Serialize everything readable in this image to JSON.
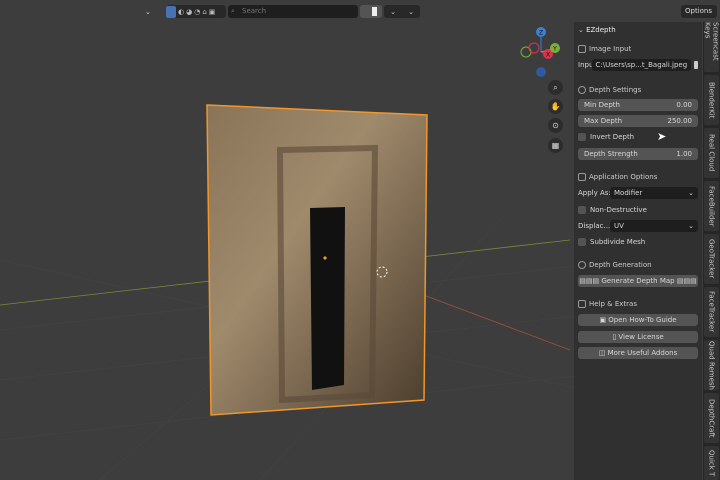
{
  "header": {
    "search_placeholder": "Search",
    "options_label": "Options"
  },
  "gizmo": {
    "z": "Z",
    "y": "Y",
    "x": "X"
  },
  "panel": {
    "title": "EZdepth",
    "image_input": {
      "heading": "Image Input",
      "label": "Input I...",
      "value": "C:\\Users\\sp...t_Bagali.jpeg"
    },
    "depth_settings": {
      "heading": "Depth Settings",
      "min_label": "Min Depth",
      "min_value": "0.00",
      "max_label": "Max Depth",
      "max_value": "250.00",
      "invert_label": "Invert Depth",
      "strength_label": "Depth Strength",
      "strength_value": "1.00"
    },
    "application": {
      "heading": "Application Options",
      "apply_label": "Apply As:",
      "apply_value": "Modifier",
      "nondestructive_label": "Non-Destructive",
      "displace_label": "Displac...",
      "displace_value": "UV",
      "subdivide_label": "Subdivide Mesh"
    },
    "generation": {
      "heading": "Depth Generation",
      "button": "Generate Depth Map"
    },
    "help": {
      "heading": "Help & Extras",
      "guide": "Open How-To Guide",
      "license": "View License",
      "addons": "More Useful Addons"
    }
  },
  "tabs": [
    "Screencast Keys",
    "BlenderKit",
    "Real Cloud",
    "FaceBuilder",
    "GeoTracker",
    "FaceTracker",
    "Quad Remesh",
    "DepthCraft",
    "Quick T"
  ]
}
